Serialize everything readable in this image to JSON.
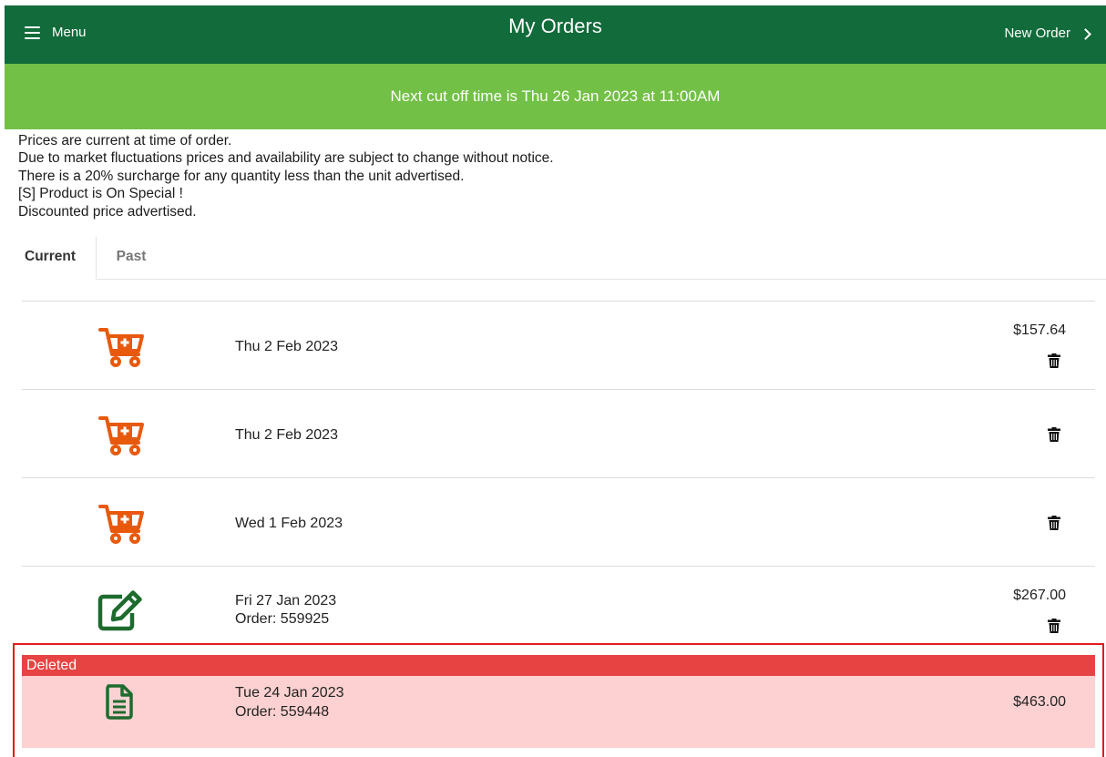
{
  "header": {
    "menu_label": "Menu",
    "title": "My Orders",
    "new_order_label": "New Order"
  },
  "banner": {
    "cutoff_text": "Next cut off time is Thu 26 Jan 2023 at 11:00AM"
  },
  "notices": [
    "Prices are current at time of order.",
    "Due to market fluctuations prices and availability are subject to change without notice.",
    "There is a 20% surcharge for any quantity less than the unit advertised.",
    "[S] Product is On Special !",
    "Discounted price advertised."
  ],
  "tabs": [
    {
      "label": "Current",
      "active": true
    },
    {
      "label": "Past",
      "active": false
    }
  ],
  "orders": [
    {
      "icon": "cart-plus-icon",
      "date": "Thu 2 Feb 2023",
      "order": "",
      "price": "$157.64",
      "deletable": true
    },
    {
      "icon": "cart-plus-icon",
      "date": "Thu 2 Feb 2023",
      "order": "",
      "price": "",
      "deletable": true
    },
    {
      "icon": "cart-plus-icon",
      "date": "Wed 1 Feb 2023",
      "order": "",
      "price": "",
      "deletable": true
    },
    {
      "icon": "edit-icon",
      "date": "Fri 27 Jan 2023",
      "order": "Order: 559925",
      "price": "$267.00",
      "deletable": true
    },
    {
      "icon": "document-icon",
      "date": "Tue 24 Jan 2023",
      "order": "Order: 559448",
      "price": "$463.00",
      "deletable": false,
      "status": "Deleted"
    }
  ],
  "colors": {
    "header_bg": "#116b3a",
    "banner_bg": "#72c045",
    "cart_icon": "#e8590c",
    "edit_icon": "#1e6b2e",
    "deleted_bar": "#e84343",
    "deleted_bg": "#fdd1d1",
    "deleted_outline": "#e11b1b"
  }
}
